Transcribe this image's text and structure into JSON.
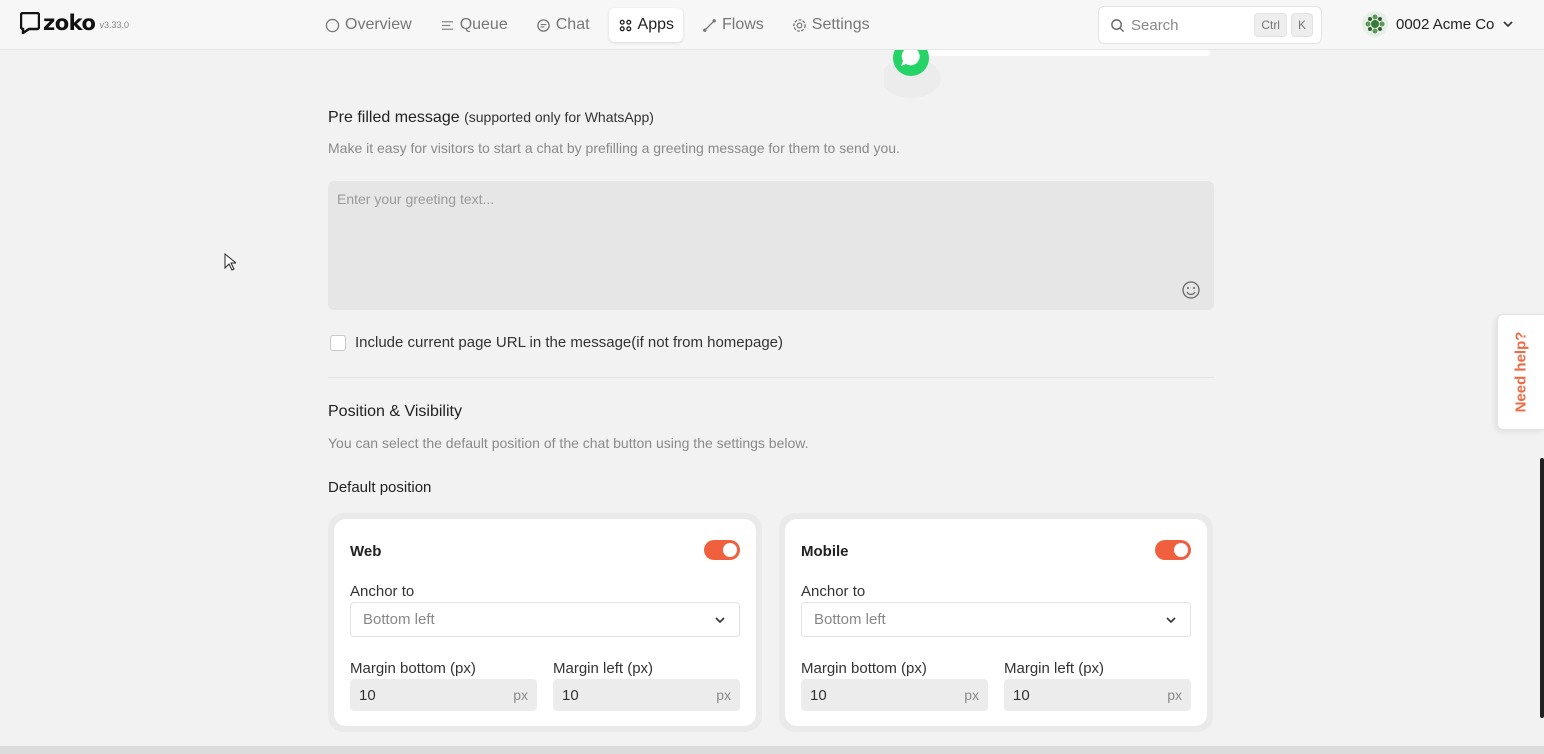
{
  "app": {
    "name": "zoko",
    "version": "v3.33.0"
  },
  "nav": [
    {
      "label": "Overview",
      "icon": "circle-icon",
      "active": false
    },
    {
      "label": "Queue",
      "icon": "queue-icon",
      "active": false
    },
    {
      "label": "Chat",
      "icon": "chat-icon",
      "active": false
    },
    {
      "label": "Apps",
      "icon": "grid-icon",
      "active": true
    },
    {
      "label": "Flows",
      "icon": "flow-icon",
      "active": false
    },
    {
      "label": "Settings",
      "icon": "gear-icon",
      "active": false
    }
  ],
  "search": {
    "label": "Search",
    "shortcut": [
      "Ctrl",
      "K"
    ]
  },
  "account": {
    "name": "0002 Acme Co"
  },
  "prefill": {
    "title": "Pre filled message",
    "title_note": "(supported only for WhatsApp)",
    "description": "Make it easy for visitors to start a chat by prefilling a greeting message for them to send you.",
    "placeholder": "Enter your greeting text...",
    "include_url_label": "Include current page URL in the message(if not from homepage)"
  },
  "position": {
    "title": "Position & Visibility",
    "description": "You can select the default position of the chat button using the settings below.",
    "default_label": "Default position",
    "web": {
      "title": "Web",
      "anchor_label": "Anchor to",
      "anchor_value": "Bottom left",
      "margin_bottom_label": "Margin bottom (px)",
      "margin_bottom_value": "10",
      "margin_left_label": "Margin left (px)",
      "margin_left_value": "10",
      "unit": "px",
      "enabled": true
    },
    "mobile": {
      "title": "Mobile",
      "anchor_label": "Anchor to",
      "anchor_value": "Bottom left",
      "margin_bottom_label": "Margin bottom (px)",
      "margin_bottom_value": "10",
      "margin_left_label": "Margin left (px)",
      "margin_left_value": "10",
      "unit": "px",
      "enabled": true
    }
  },
  "help_tab": {
    "label": "Need help?"
  },
  "colors": {
    "accent": "#f0603e",
    "whatsapp": "#25d366"
  }
}
